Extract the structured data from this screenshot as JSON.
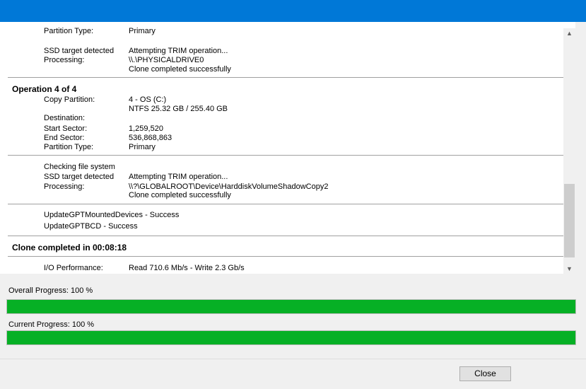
{
  "log": {
    "top_partition": {
      "label": "Partition Type:",
      "value": "Primary"
    },
    "block1": {
      "ssd_label": "SSD target detected",
      "ssd_value": "Attempting TRIM operation...",
      "processing_label": "Processing:",
      "processing_value": "\\\\.\\PHYSICALDRIVE0",
      "result": "Clone completed successfully"
    },
    "operation": {
      "header": "Operation 4 of 4",
      "copy_label": "Copy Partition:",
      "copy_value": "4 - OS (C:)",
      "copy_fs": "NTFS 25.32 GB / 255.40 GB",
      "dest_label": "Destination:",
      "start_label": "Start Sector:",
      "start_value": "1,259,520",
      "end_label": "End Sector:",
      "end_value": "536,868,863",
      "ptype_label": "Partition Type:",
      "ptype_value": "Primary"
    },
    "block2": {
      "checking": "Checking file system",
      "ssd_label": "SSD target detected",
      "ssd_value": "Attempting TRIM operation...",
      "processing_label": "Processing:",
      "processing_value": "\\\\?\\GLOBALROOT\\Device\\HarddiskVolumeShadowCopy2",
      "result": "Clone completed successfully"
    },
    "block3": {
      "line1": "UpdateGPTMountedDevices - Success",
      "line2": "UpdateGPTBCD - Success"
    },
    "completed": "Clone completed in 00:08:18",
    "io": {
      "label": "I/O Performance:",
      "value": "Read 710.6 Mb/s - Write 2.3 Gb/s"
    }
  },
  "scroll": {
    "up_icon": "▲",
    "down_icon": "▼",
    "position": 0.74
  },
  "progress": {
    "overall_label": "Overall Progress:  100 %",
    "overall_value": 100,
    "current_label": "Current Progress:  100 %",
    "current_value": 100,
    "fill_color": "#06b025"
  },
  "footer": {
    "close_label": "Close"
  }
}
